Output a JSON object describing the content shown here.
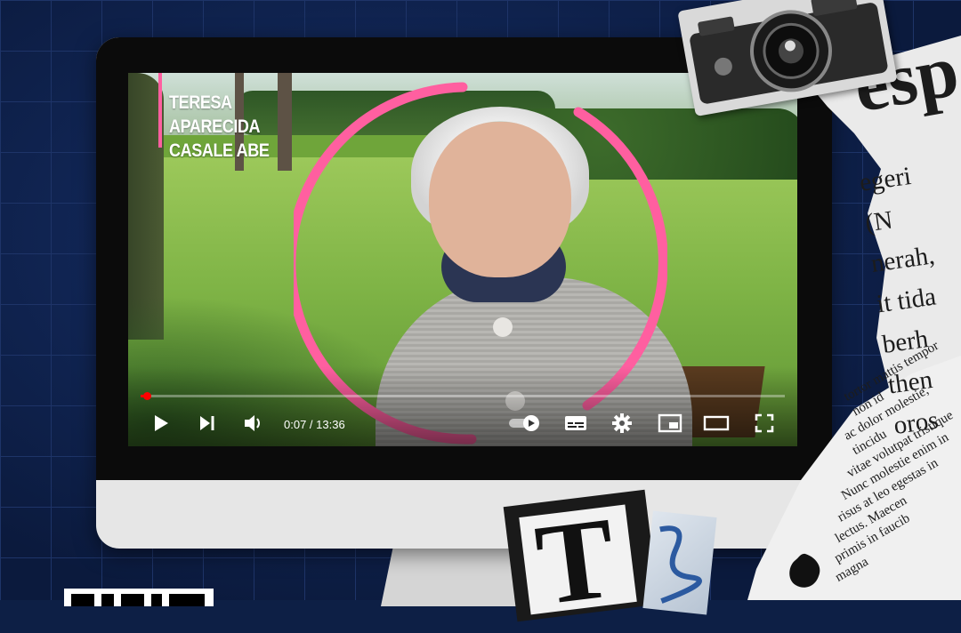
{
  "video": {
    "name_lines": [
      "TERESA",
      "APARECIDA",
      "CASALE ABE"
    ],
    "time_current": "0:07",
    "time_separator": " / ",
    "time_total": "13:36",
    "progress_fraction": 0.009
  },
  "collage": {
    "headline_fragment": "esp",
    "news_lines": [
      "egeri (N",
      "nerah,",
      "it tida",
      "berh",
      "then",
      "oros"
    ],
    "latin_lines": [
      "tortor mattis tempor non id",
      "ac dolor molestie, tincidu",
      "vitae volutpat tristique",
      "Nunc molestie enim in",
      "risus at leo egestas in",
      "lectus. Maecen",
      "primis in faucib",
      "magna"
    ],
    "letter": "T"
  },
  "colors": {
    "accent_pink": "#ff5fa0",
    "progress_red": "#ff0000",
    "background_navy": "#0d1f45"
  },
  "icons": [
    "play-icon",
    "next-icon",
    "volume-icon",
    "autoplay-toggle-icon",
    "subtitles-icon",
    "settings-icon",
    "miniplayer-icon",
    "theater-mode-icon",
    "fullscreen-icon"
  ]
}
